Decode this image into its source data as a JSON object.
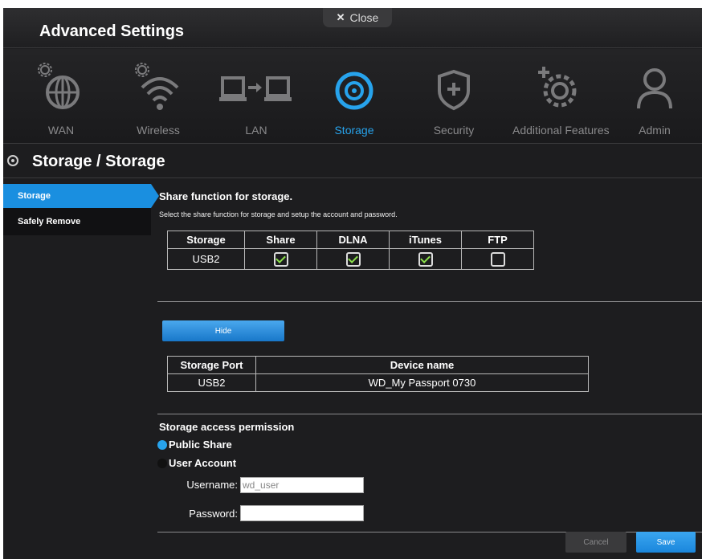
{
  "header": {
    "title": "Advanced Settings",
    "close_label": "Close"
  },
  "nav": [
    {
      "id": "wan",
      "label": "WAN",
      "icon": "globe-gear-icon",
      "active": false
    },
    {
      "id": "wireless",
      "label": "Wireless",
      "icon": "wifi-gear-icon",
      "active": false
    },
    {
      "id": "lan",
      "label": "LAN",
      "icon": "lan-computers-icon",
      "active": false
    },
    {
      "id": "storage",
      "label": "Storage",
      "icon": "storage-disk-icon",
      "active": true
    },
    {
      "id": "security",
      "label": "Security",
      "icon": "shield-plus-icon",
      "active": false
    },
    {
      "id": "additional",
      "label": "Additional Features",
      "icon": "gear-plus-icon",
      "active": false
    },
    {
      "id": "admin",
      "label": "Admin",
      "icon": "user-icon",
      "active": false
    }
  ],
  "page": {
    "title": "Storage / Storage"
  },
  "sidebar": {
    "items": [
      {
        "label": "Storage",
        "active": true
      },
      {
        "label": "Safely Remove",
        "active": false
      }
    ]
  },
  "share": {
    "title": "Share function for storage.",
    "description": "Select the share function for storage and setup the account and password.",
    "headers": [
      "Storage",
      "Share",
      "DLNA",
      "iTunes",
      "FTP"
    ],
    "rows": [
      {
        "storage": "USB2",
        "share": true,
        "dlna": true,
        "itunes": true,
        "ftp": false
      }
    ]
  },
  "hide_label": "Hide",
  "device": {
    "headers": [
      "Storage Port",
      "Device name"
    ],
    "rows": [
      {
        "port": "USB2",
        "name": "WD_My Passport 0730"
      }
    ]
  },
  "permission": {
    "title": "Storage access permission",
    "options": [
      {
        "label": "Public Share",
        "selected": true
      },
      {
        "label": "User Account",
        "selected": false
      }
    ],
    "username_label": "Username:",
    "username_value": "wd_user",
    "password_label": "Password:",
    "password_value": ""
  },
  "footer": {
    "cancel_label": "Cancel",
    "save_label": "Save"
  },
  "colors": {
    "accent": "#27a3ec",
    "background": "#1d1d1f",
    "check": "#8be04a"
  }
}
